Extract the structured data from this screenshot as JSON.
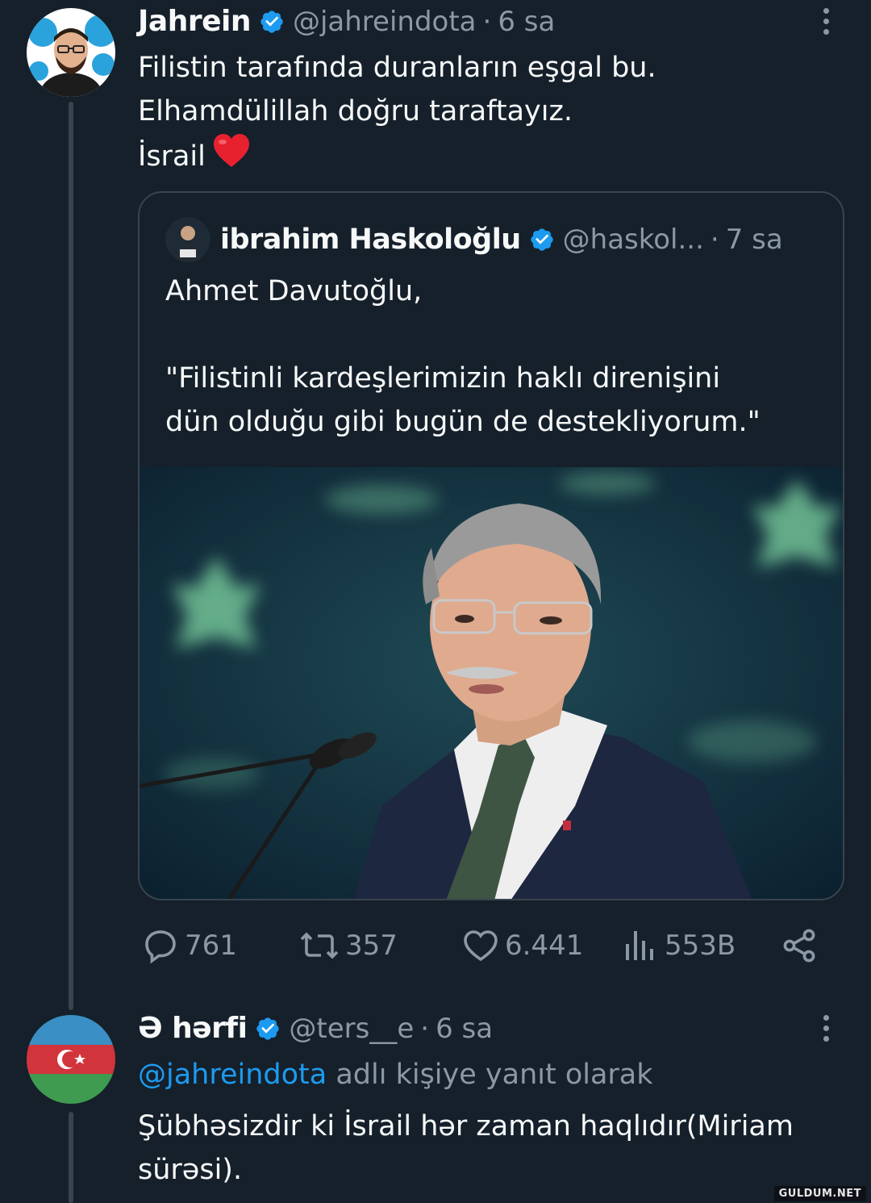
{
  "tweet1": {
    "display_name": "Jahrein",
    "handle": "@jahreindota",
    "separator": "·",
    "time": "6 sa",
    "text_lines": [
      "Filistin tarafında duranların eşgal bu.",
      "Elhamdülillah doğru taraftayız.",
      "İsrail"
    ],
    "quote": {
      "display_name": "ibrahim Haskoloğlu",
      "handle": "@haskol...",
      "separator": "·",
      "time": "7 sa",
      "text_lines": [
        "Ahmet Davutoğlu,",
        "",
        "\"Filistinli kardeşlerimizin haklı direnişini",
        "dün olduğu gibi bugün de destekliyorum.\""
      ]
    },
    "stats": {
      "replies": "761",
      "retweets": "357",
      "likes": "6.441",
      "views": "553B"
    }
  },
  "tweet2": {
    "display_name": "Ə hərfi",
    "handle": "@ters__e",
    "separator": "·",
    "time": "6 sa",
    "reply_mention": "@jahreindota",
    "reply_suffix": " adlı kişiye yanıt olarak",
    "text_lines": [
      "Şübhəsizdir ki İsrail hər zaman haqlıdır(Miriam",
      "sürəsi)."
    ]
  },
  "watermark": "GULDUM.NET",
  "colors": {
    "background": "#15202b",
    "text": "#f7f9f9",
    "muted": "#8b98a5",
    "accent": "#1d9bf0",
    "border": "#38444d"
  }
}
